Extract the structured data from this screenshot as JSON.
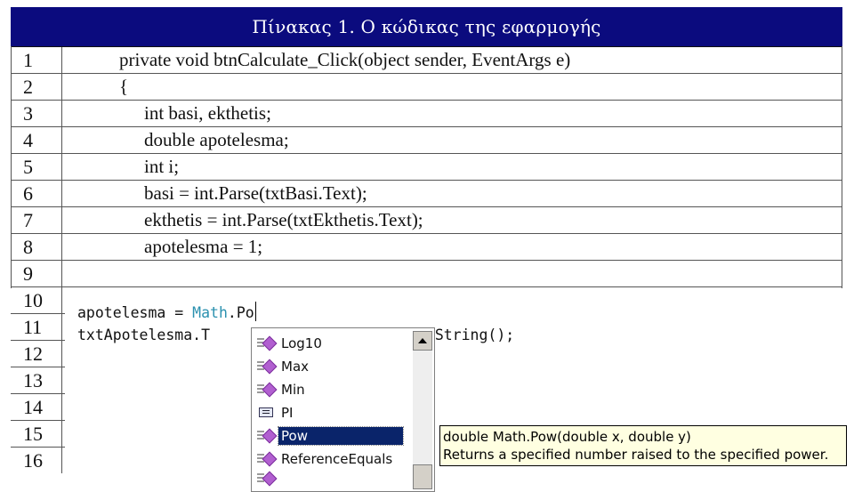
{
  "table": {
    "title": "Πίνακας 1. Ο κώδικας της εφαρμογής",
    "rows": [
      {
        "num": "1",
        "code": "private void btnCalculate_Click(object sender, EventArgs e)"
      },
      {
        "num": "2",
        "code": "{"
      },
      {
        "num": "3",
        "code": "int basi, ekthetis;"
      },
      {
        "num": "4",
        "code": "double apotelesma;"
      },
      {
        "num": "5",
        "code": "int i;"
      },
      {
        "num": "6",
        "code": "basi = int.Parse(txtBasi.Text);"
      },
      {
        "num": "7",
        "code": "ekthetis = int.Parse(txtEkthetis.Text);"
      },
      {
        "num": "8",
        "code": "apotelesma = 1;"
      },
      {
        "num": "9",
        "code": ""
      }
    ],
    "lower_rows": [
      "10",
      "11",
      "12",
      "13",
      "14",
      "15",
      "16"
    ]
  },
  "editor": {
    "line10_prefix": "apotelesma = ",
    "line10_type": "Math",
    "line10_suffix": ".Po",
    "line11_prefix": "txtApotelesma.T",
    "line11_suffix": ".ToString();"
  },
  "intellisense": {
    "items": [
      {
        "label": "Log10",
        "icon": "method-icon"
      },
      {
        "label": "Max",
        "icon": "method-icon"
      },
      {
        "label": "Min",
        "icon": "method-icon"
      },
      {
        "label": "PI",
        "icon": "field-icon"
      },
      {
        "label": "Pow",
        "icon": "method-icon",
        "selected": true
      },
      {
        "label": "ReferenceEquals",
        "icon": "method-icon"
      }
    ]
  },
  "tooltip": {
    "signature": "double Math.Pow(double x, double y)",
    "description": "Returns a specified number raised to the specified power."
  },
  "colors": {
    "title_bar": "#0b0b7e",
    "type_highlight": "#2b91af",
    "selection": "#0a246a",
    "tooltip_bg": "#ffffe1"
  }
}
